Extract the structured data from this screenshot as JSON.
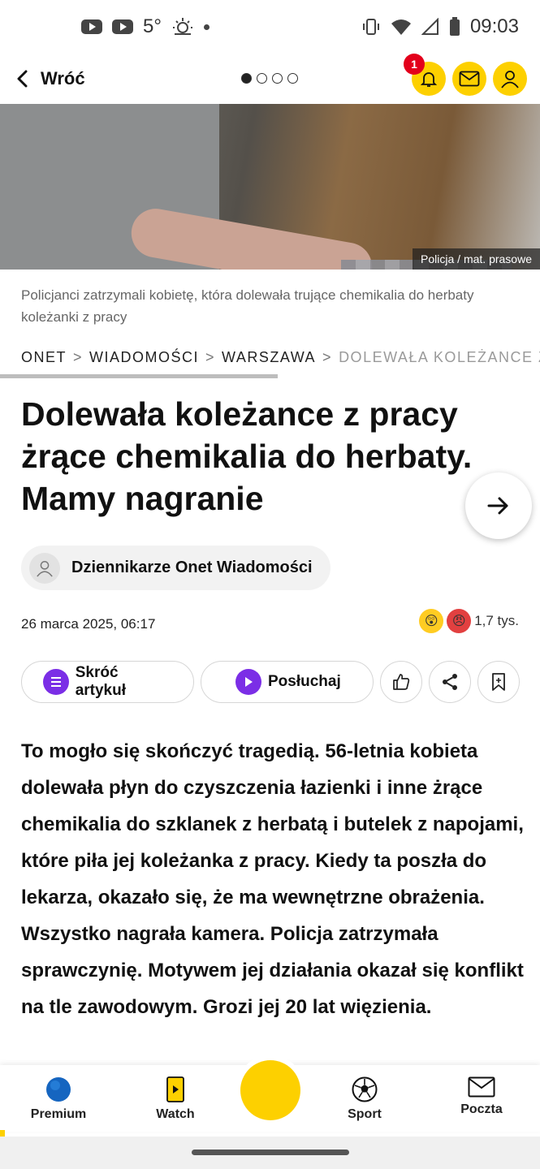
{
  "status_bar": {
    "temperature": "5°",
    "time": "09:03"
  },
  "header": {
    "back_label": "Wróć",
    "pager": {
      "count": 4,
      "active": 1
    },
    "notification_count": "1"
  },
  "hero": {
    "credit": "Policja / mat. prasowe",
    "caption": "Policjanci zatrzymali kobietę, która dolewała trujące chemikalia do herbaty koleżanki z pracy"
  },
  "breadcrumb": [
    "ONET",
    "WIADOMOŚCI",
    "WARSZAWA",
    "DOLEWAŁA KOLEŻANCE Z"
  ],
  "article": {
    "title": "Dolewała koleżance z pracy żrące chemikalia do herbaty. Mamy nagranie",
    "author": "Dziennikarze Onet Wiadomości",
    "date": "26 marca 2025, 06:17",
    "reactions_count": "1,7 tys.",
    "lead": "To mogło się skończyć tragedią. 56-letnia kobieta dolewała płyn do czyszczenia łazienki i inne żrące chemikalia do szklanek z herbatą i butelek z napojami, które piła jej koleżanka z pracy. Kiedy ta poszła do lekarza, okazało się, że ma wewnętrzne obrażenia. Wszystko nagrała kamera. Policja zatrzymała sprawczynię. Motywem jej działania okazał się konflikt na tle zawodowym. Grozi jej 20 lat więzienia."
  },
  "actions": {
    "summarize": "Skróć artykuł",
    "listen": "Posłuchaj"
  },
  "bottom_nav": {
    "premium": "Premium",
    "watch": "Watch",
    "sport": "Sport",
    "mail": "Poczta"
  },
  "colors": {
    "brand_yellow": "#fdd000",
    "accent_purple": "#7b2ee6",
    "badge_red": "#e3001b"
  }
}
